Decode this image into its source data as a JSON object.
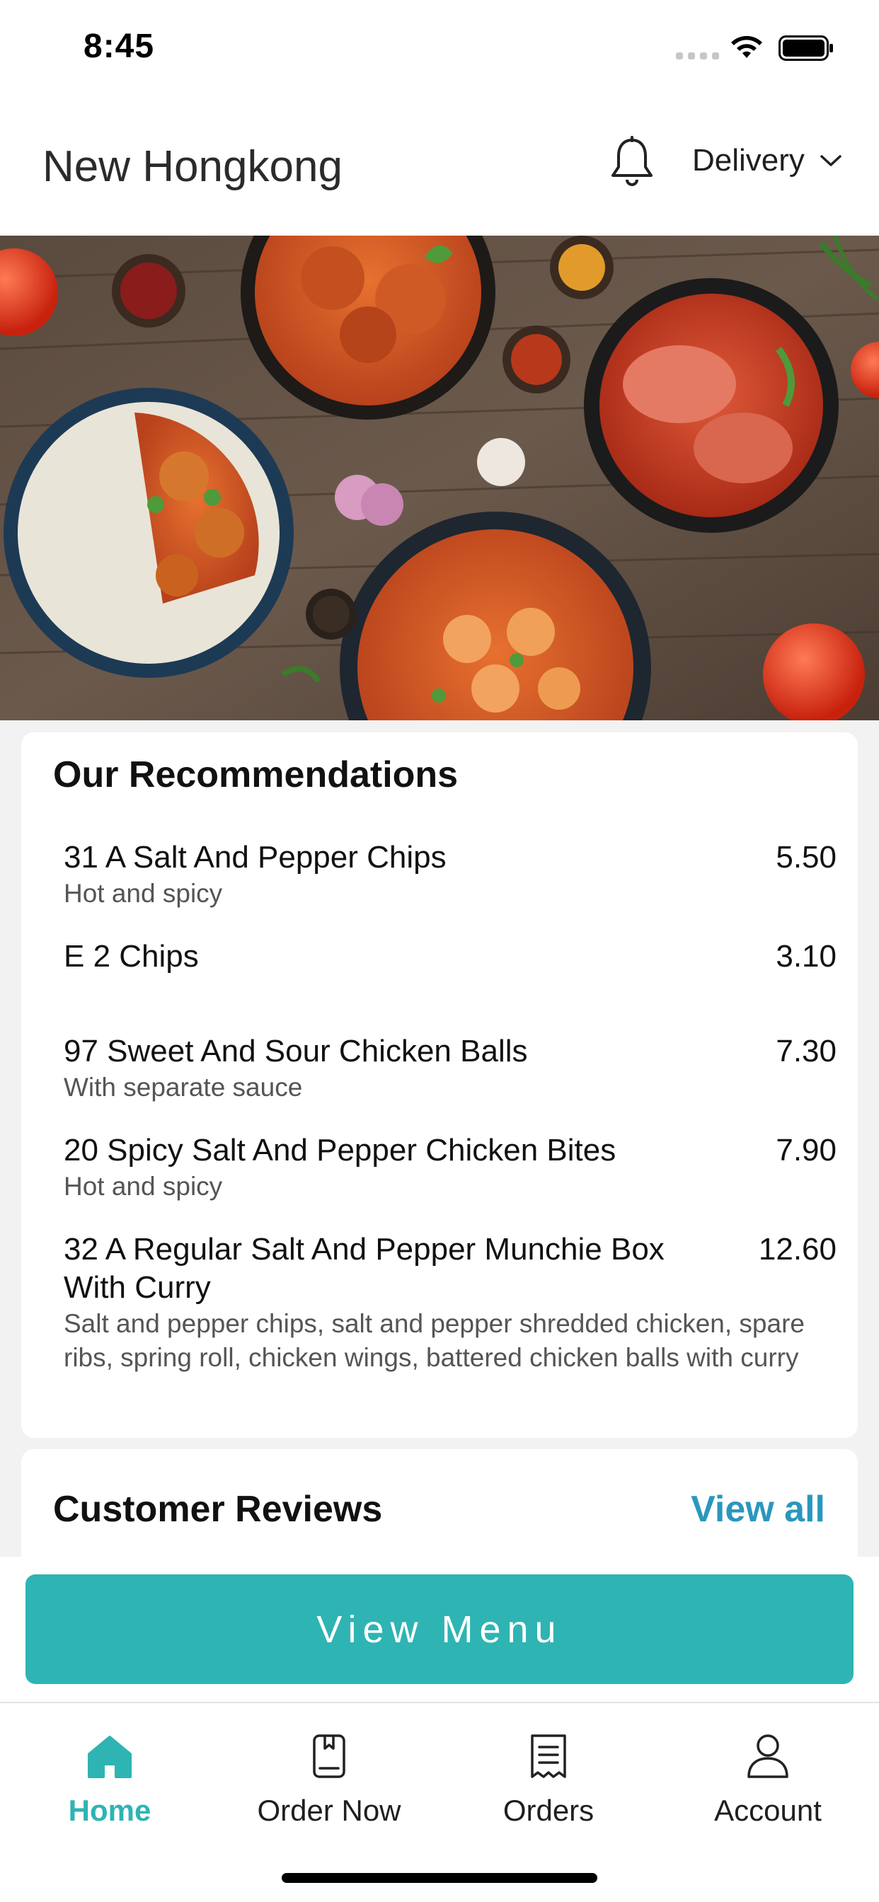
{
  "status_bar": {
    "time": "8:45"
  },
  "header": {
    "title": "New Hongkong",
    "order_type": "Delivery"
  },
  "recommendations": {
    "heading": "Our Recommendations",
    "items": [
      {
        "name": "31 A Salt And Pepper Chips",
        "price": "5.50",
        "description": "Hot and spicy"
      },
      {
        "name": "E 2 Chips",
        "price": "3.10",
        "description": ""
      },
      {
        "name": "97 Sweet And Sour Chicken Balls",
        "price": "7.30",
        "description": "With separate sauce"
      },
      {
        "name": "20 Spicy Salt And Pepper Chicken Bites",
        "price": "7.90",
        "description": "Hot and spicy"
      },
      {
        "name": "32 A Regular Salt And Pepper Munchie Box With Curry",
        "price": "12.60",
        "description": "Salt and pepper chips, salt and pepper shredded chicken, spare ribs, spring roll, chicken wings, battered chicken balls with curry"
      }
    ]
  },
  "reviews": {
    "heading": "Customer Reviews",
    "view_all": "View all"
  },
  "view_menu_label": "View Menu",
  "bottom_nav": {
    "items": [
      {
        "label": "Home",
        "icon": "home-icon",
        "active": true
      },
      {
        "label": "Order Now",
        "icon": "menu-book-icon",
        "active": false
      },
      {
        "label": "Orders",
        "icon": "receipt-icon",
        "active": false
      },
      {
        "label": "Account",
        "icon": "user-icon",
        "active": false
      }
    ]
  },
  "colors": {
    "accent": "#2eb4b3",
    "link": "#2a97bd",
    "background": "#f2f2f2"
  }
}
